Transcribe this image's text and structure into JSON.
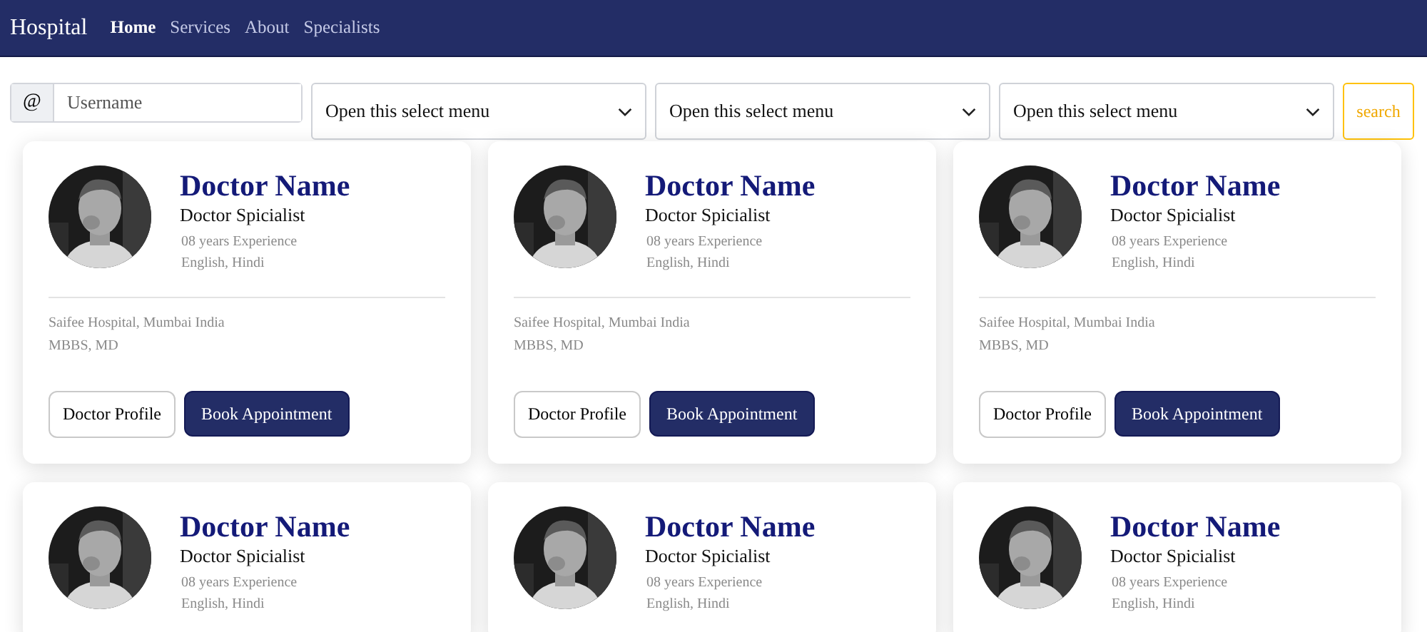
{
  "navbar": {
    "brand": "Hospital",
    "links": [
      {
        "label": "Home",
        "selected": true
      },
      {
        "label": "Services",
        "selected": false
      },
      {
        "label": "About",
        "selected": false
      },
      {
        "label": "Specialists",
        "selected": false
      }
    ]
  },
  "filters": {
    "username": {
      "prefix": "@",
      "placeholder": "Username"
    },
    "selects": [
      "Open this select menu",
      "Open this select menu",
      "Open this select menu"
    ],
    "search_button": "search"
  },
  "doctors": [
    {
      "name": "Doctor Name",
      "specialty": "Doctor Spicialist",
      "experience": "08 years Experience",
      "languages": "English, Hindi",
      "hospital": "Saifee Hospital, Mumbai India",
      "degree": "MBBS, MD",
      "profile_button": "Doctor Profile",
      "book_button": "Book Appointment"
    },
    {
      "name": "Doctor Name",
      "specialty": "Doctor Spicialist",
      "experience": "08 years Experience",
      "languages": "English, Hindi",
      "hospital": "Saifee Hospital, Mumbai India",
      "degree": "MBBS, MD",
      "profile_button": "Doctor Profile",
      "book_button": "Book Appointment"
    },
    {
      "name": "Doctor Name",
      "specialty": "Doctor Spicialist",
      "experience": "08 years Experience",
      "languages": "English, Hindi",
      "hospital": "Saifee Hospital, Mumbai India",
      "degree": "MBBS, MD",
      "profile_button": "Doctor Profile",
      "book_button": "Book Appointment"
    },
    {
      "name": "Doctor Name",
      "specialty": "Doctor Spicialist",
      "experience": "08 years Experience",
      "languages": "English, Hindi"
    },
    {
      "name": "Doctor Name",
      "specialty": "Doctor Spicialist",
      "experience": "08 years Experience",
      "languages": "English, Hindi"
    },
    {
      "name": "Doctor Name",
      "specialty": "Doctor Spicialist",
      "experience": "08 years Experience",
      "languages": "English, Hindi"
    }
  ]
}
